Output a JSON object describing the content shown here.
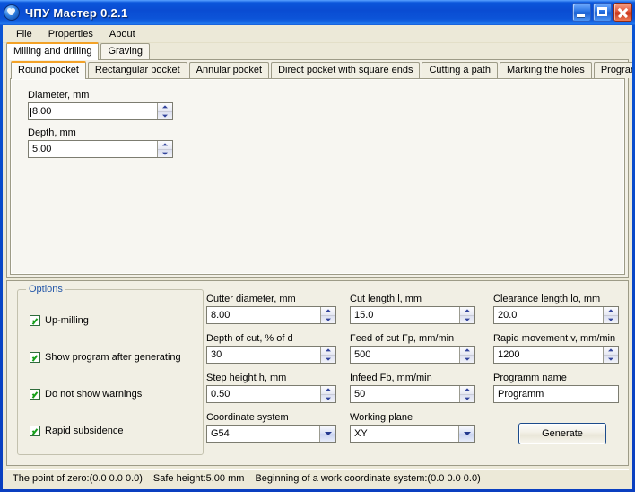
{
  "window": {
    "title": "ЧПУ Мастер 0.2.1",
    "icon": "app-disc-icon",
    "buttons": {
      "minimize": "minimize-icon",
      "maximize": "maximize-icon",
      "close": "close-icon"
    }
  },
  "menubar": {
    "items": [
      {
        "label": "File"
      },
      {
        "label": "Properties"
      },
      {
        "label": "About"
      }
    ]
  },
  "outer_tabs": {
    "active_index": 0,
    "items": [
      {
        "label": "Milling and drilling"
      },
      {
        "label": "Graving"
      }
    ]
  },
  "inner_tabs": {
    "active_index": 0,
    "items": [
      {
        "label": "Round pocket"
      },
      {
        "label": "Rectangular pocket"
      },
      {
        "label": "Annular pocket"
      },
      {
        "label": "Direct pocket with square ends"
      },
      {
        "label": "Cutting a path"
      },
      {
        "label": "Marking the holes"
      },
      {
        "label": "Programm"
      }
    ]
  },
  "round_pocket": {
    "diameter": {
      "label": "Diameter, mm",
      "value": "8.00"
    },
    "depth": {
      "label": "Depth, mm",
      "value": "5.00"
    }
  },
  "options": {
    "legend": "Options",
    "items": [
      {
        "label": "Up-milling",
        "checked": true
      },
      {
        "label": "Show program after generating",
        "checked": true
      },
      {
        "label": "Do not show warnings",
        "checked": true
      },
      {
        "label": "Rapid subsidence",
        "checked": true
      }
    ]
  },
  "params": {
    "cutter_diameter": {
      "label": "Cutter diameter, mm",
      "value": "8.00"
    },
    "depth_of_cut": {
      "label": "Depth of cut, % of d",
      "value": "30"
    },
    "step_height": {
      "label": "Step height h, mm",
      "value": "0.50"
    },
    "coordinate_system": {
      "label": "Coordinate system",
      "value": "G54"
    },
    "cut_length": {
      "label": "Cut length l, mm",
      "value": "15.0"
    },
    "feed_of_cut": {
      "label": "Feed of cut Fp, mm/min",
      "value": "500"
    },
    "infeed": {
      "label": "Infeed Fb, mm/min",
      "value": "50"
    },
    "working_plane": {
      "label": "Working plane",
      "value": "XY"
    },
    "clearance_length": {
      "label": "Clearance length lo, mm",
      "value": "20.0"
    },
    "rapid_movement": {
      "label": "Rapid movement v, mm/min",
      "value": "1200"
    },
    "programm_name": {
      "label": "Programm name",
      "value": "Programm"
    }
  },
  "generate_button": {
    "label": "Generate"
  },
  "statusbar": {
    "point_of_zero": "The point of zero:(0.0  0.0  0.0)",
    "safe_height": "Safe height:5.00 mm",
    "work_coordinate_system": "Beginning of a work coordinate system:(0.0  0.0  0.0)"
  },
  "colors": {
    "title_bar_blue": "#0A4CD2",
    "active_tab_accent": "#F3A227",
    "group_legend_blue": "#2457A8",
    "check_green": "#17A01A",
    "face": "#ECE9D8"
  }
}
